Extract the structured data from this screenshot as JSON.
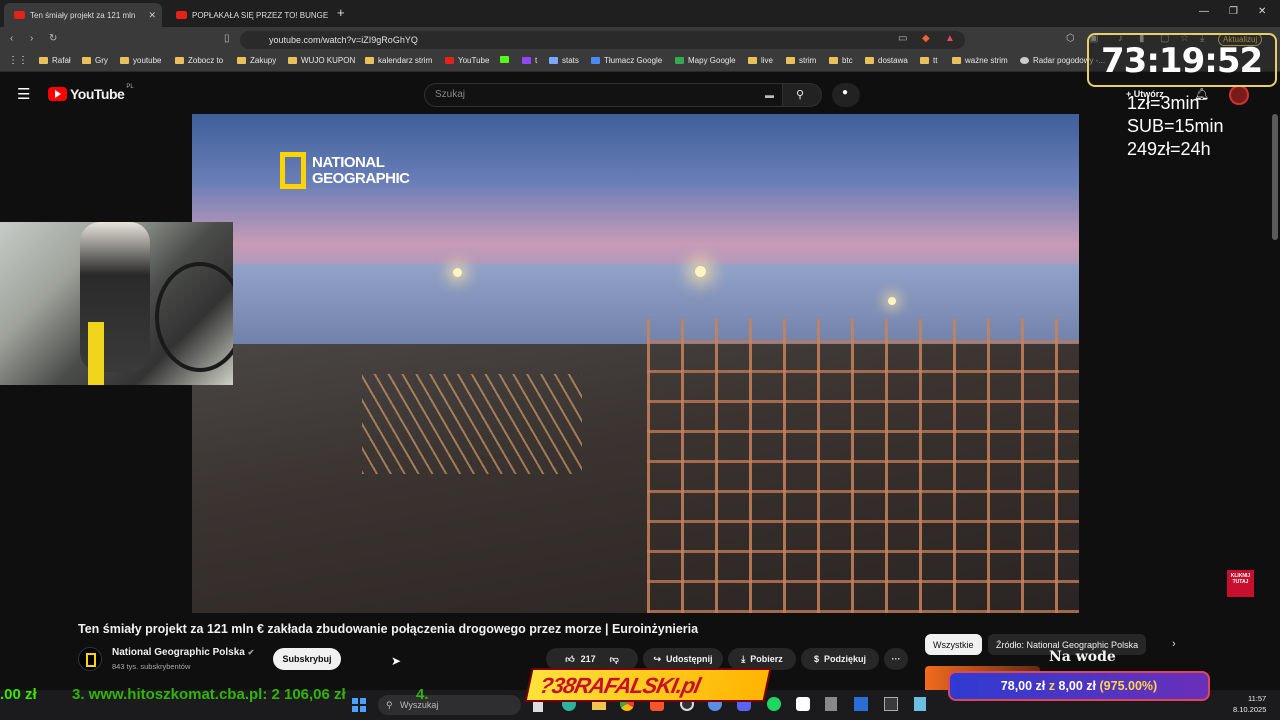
{
  "tabs": [
    {
      "label": "Ten śmiały projekt za 121 mln"
    },
    {
      "label": "POPŁAKAŁA SIĘ PRZEZ TO! BUNGEE"
    }
  ],
  "address": {
    "url": "youtube.com/watch?v=iZI9gRoGhYQ"
  },
  "update_label": "Aktualizuj",
  "bookmarks": [
    "Rafał",
    "Gry",
    "youtube",
    "Zobocz to",
    "Zakupy",
    "WUJO KUPON",
    "kalendarz strim",
    "YouTube",
    "t",
    "stats",
    "Tłumacz Google",
    "Mapy Google",
    "live",
    "strim",
    "btc",
    "dostawa",
    "tt",
    "ważne strim",
    "Radar pogodowy -..."
  ],
  "youtube": {
    "logo": "YouTube",
    "region": "PL",
    "search_placeholder": "Szukaj",
    "create_label": "Utwórz"
  },
  "overlay": {
    "timer": "73:19:52",
    "rates": [
      "1zł=3min",
      "SUB=15min",
      "249zł=24h"
    ]
  },
  "video": {
    "watermark": "NATIONAL GEOGRAPHIC",
    "corner_badge": "KLIKNIJ TUTAJ"
  },
  "video_info": {
    "title": "Ten śmiały projekt za 121 mln € zakłada zbudowanie połączenia drogowego przez morze | Euroinżynieria",
    "channel": "National Geographic Polska",
    "subscribers": "843 tys. subskrybentów",
    "subscribe": "Subskrybuj",
    "likes": "217",
    "share": "Udostępnij",
    "download": "Pobierz",
    "thanks": "Podziękuj"
  },
  "chips": [
    "Wszystkie",
    "Źródło: National Geographic Polska"
  ],
  "recommendation_text": "Na wode",
  "ticker": {
    "left": ".00 zł",
    "text": "3. www.hitoszkomat.cba.pl: 2 106,06 zł",
    "number": "4."
  },
  "brand_banner": "?38RAFALSKI.pl",
  "donation": {
    "amount": "78,00 zł",
    "connector": "z",
    "goal": "8,00 zł",
    "percent": "(975.00%)"
  },
  "taskbar": {
    "search_placeholder": "Wyszukaj",
    "time": "11:57",
    "date": "8.10.2025"
  },
  "colors": {
    "accent_red": "#ff0000",
    "overlay_gold": "#e7d06a",
    "ticker_green": "#39e600"
  }
}
